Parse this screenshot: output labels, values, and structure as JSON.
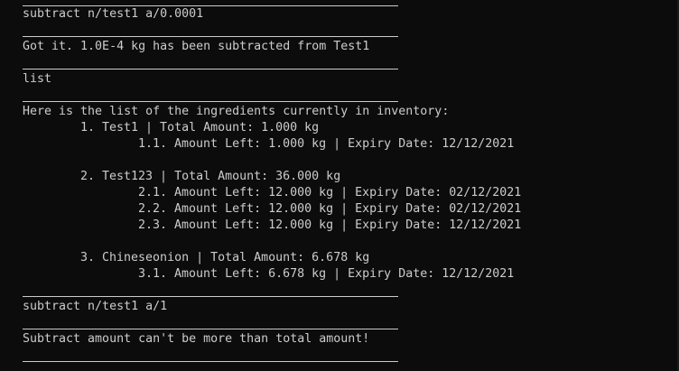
{
  "terminal": {
    "cmd1": "subtract n/test1 a/0.0001",
    "resp1": "Got it. 1.0E-4 kg has been subtracted from Test1",
    "cmd2": "list",
    "list_header": "Here is the list of the ingredients currently in inventory:",
    "items": [
      {
        "title": "1. Test1 | Total Amount: 1.000 kg",
        "batches": [
          "1.1. Amount Left: 1.000 kg | Expiry Date: 12/12/2021"
        ]
      },
      {
        "title": "2. Test123 | Total Amount: 36.000 kg",
        "batches": [
          "2.1. Amount Left: 12.000 kg | Expiry Date: 02/12/2021",
          "2.2. Amount Left: 12.000 kg | Expiry Date: 02/12/2021",
          "2.3. Amount Left: 12.000 kg | Expiry Date: 12/12/2021"
        ]
      },
      {
        "title": "3. Chineseonion | Total Amount: 6.678 kg",
        "batches": [
          "3.1. Amount Left: 6.678 kg | Expiry Date: 12/12/2021"
        ]
      }
    ],
    "cmd3": "subtract n/test1 a/1",
    "resp3": "Subtract amount can't be more than total amount!"
  }
}
